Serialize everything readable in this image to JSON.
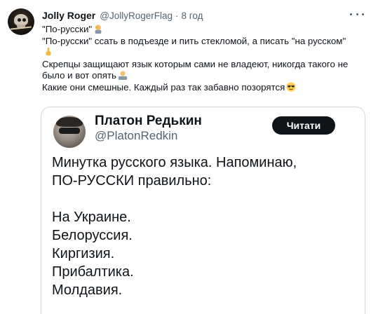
{
  "tweet": {
    "author_name": "Jolly Roger",
    "author_handle": "@JollyRogerFlag",
    "separator": "·",
    "time": "8 год",
    "lines": [
      "\"По-русски\"",
      "\"По-русски\" ссать в подъезде и пить стекломой, а писать \"на русском\"",
      "",
      "Скрепцы защищают язык которым сами не владеют, никогда такого не",
      "было и вот опять",
      "Какие они смешные. Каждый раз так забавно позорятся"
    ],
    "emojis": [
      "man-facepalming-emoji",
      "pointing-up-emoji",
      "man-shrugging-emoji",
      "sunglasses-emoji"
    ]
  },
  "quote": {
    "author_name": "Платон Редькин",
    "author_handle": "@PlatonRedkin",
    "read_button_label": "Читати",
    "body_lines": [
      "Минутка русского языка. Напоминаю,",
      "ПО-РУССКИ правильно:",
      "",
      "На Украине.",
      "Белоруссия.",
      "Киргизия.",
      "Прибалтика.",
      "Молдавия."
    ]
  },
  "colors": {
    "text": "#0f1419",
    "secondary": "#536471",
    "border": "#cfd9de",
    "button_bg": "#0f1419"
  }
}
